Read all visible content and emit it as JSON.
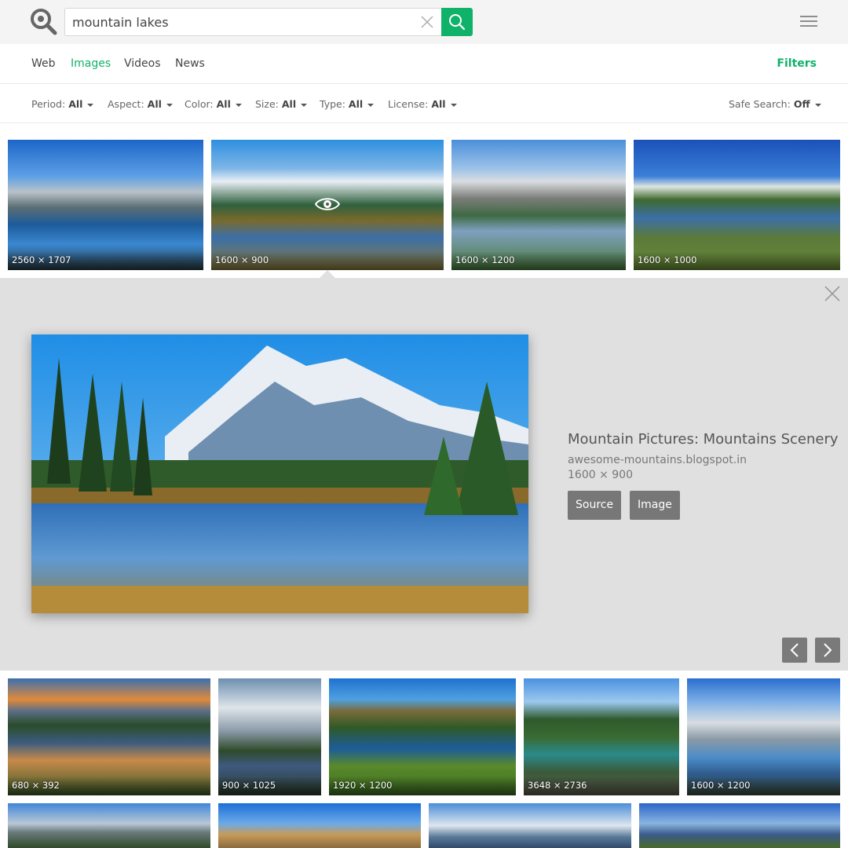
{
  "search": {
    "query": "mountain lakes"
  },
  "tabs": [
    {
      "label": "Web"
    },
    {
      "label": "Images"
    },
    {
      "label": "Videos"
    },
    {
      "label": "News"
    }
  ],
  "filters_label": "Filters",
  "filters": [
    {
      "name": "Period:",
      "value": "All"
    },
    {
      "name": "Aspect:",
      "value": "All"
    },
    {
      "name": "Color:",
      "value": "All"
    },
    {
      "name": "Size:",
      "value": "All"
    },
    {
      "name": "Type:",
      "value": "All"
    },
    {
      "name": "License:",
      "value": "All"
    }
  ],
  "safe_search": {
    "name": "Safe Search:",
    "value": "Off"
  },
  "row1": [
    "2560 × 1707",
    "1600 × 900",
    "1600 × 1200",
    "1600 × 1000"
  ],
  "preview": {
    "title": "Mountain Pictures: Mountains Scenery",
    "domain": "awesome-mountains.blogspot.in",
    "size": "1600 × 900",
    "source_label": "Source",
    "image_label": "Image"
  },
  "row2": [
    "680 × 392",
    "900 × 1025",
    "1920 × 1200",
    "3648 × 2736",
    "1600 × 1200"
  ],
  "colors": {
    "accent": "#10b26a",
    "panel": "#e0e0e0",
    "button": "#777777"
  },
  "icons": [
    "search-logo-icon",
    "clear-icon",
    "search-icon",
    "menu-icon",
    "eye-icon",
    "close-icon",
    "chevron-left-icon",
    "chevron-right-icon"
  ]
}
